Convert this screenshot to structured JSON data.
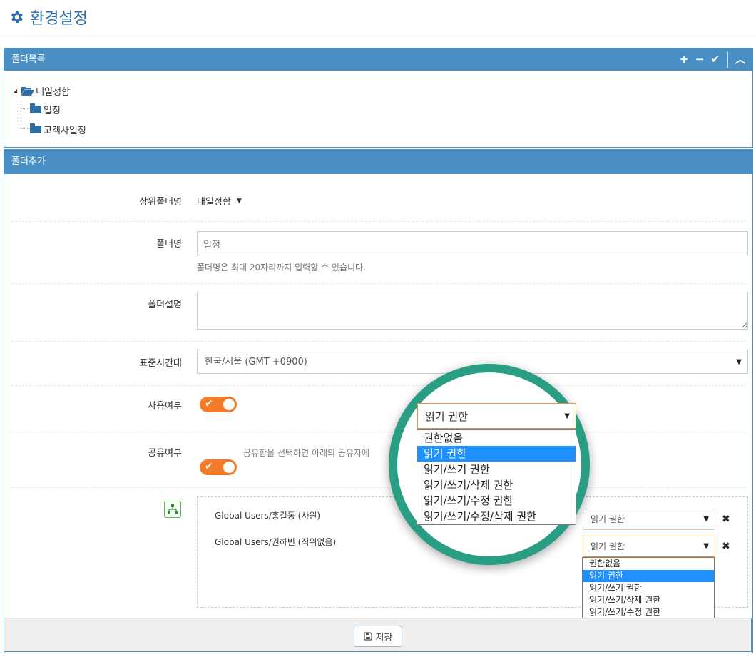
{
  "page": {
    "title": "환경설정",
    "icon": "gear-icon",
    "accent": "#4a8fc4"
  },
  "folder_list": {
    "header": "폴더목록",
    "tools": [
      "plus-icon",
      "minus-icon",
      "check-icon",
      "chevron-up-icon"
    ],
    "tree": {
      "root": "내일정함",
      "children": [
        "일정",
        "고객사일정"
      ]
    }
  },
  "folder_add": {
    "header": "폴더추가",
    "parent": {
      "label": "상위폴더명",
      "value": "내일정함"
    },
    "name": {
      "label": "폴더명",
      "value": "일정",
      "hint": "폴더명은 최대 20자리까지 입력할 수 있습니다."
    },
    "description": {
      "label": "폴더설명",
      "value": ""
    },
    "timezone": {
      "label": "표준시간대",
      "value": "한국/서울 (GMT +0900)"
    },
    "use": {
      "label": "사용여부",
      "on": true
    },
    "share": {
      "label": "공유여부",
      "on": true,
      "hint": "공유함을 선택하면 아래의 공유자에"
    },
    "sharers": [
      {
        "name": "Global Users/홍길동 (사원)",
        "permission": "읽기 권한"
      },
      {
        "name": "Global Users/권하빈 (직위없음)",
        "permission": "읽기 권한"
      }
    ],
    "permission_options": [
      "권한없음",
      "읽기 권한",
      "읽기/쓰기 권한",
      "읽기/쓰기/삭제 권한",
      "읽기/쓰기/수정 권한",
      "읽기/쓰기/수정/삭제 권한"
    ],
    "selected_option": "읽기 권한"
  },
  "zoom": {
    "select_value": "읽기 권한",
    "ring_color": "#2a9d85"
  },
  "footer": {
    "save_label": "저장"
  }
}
